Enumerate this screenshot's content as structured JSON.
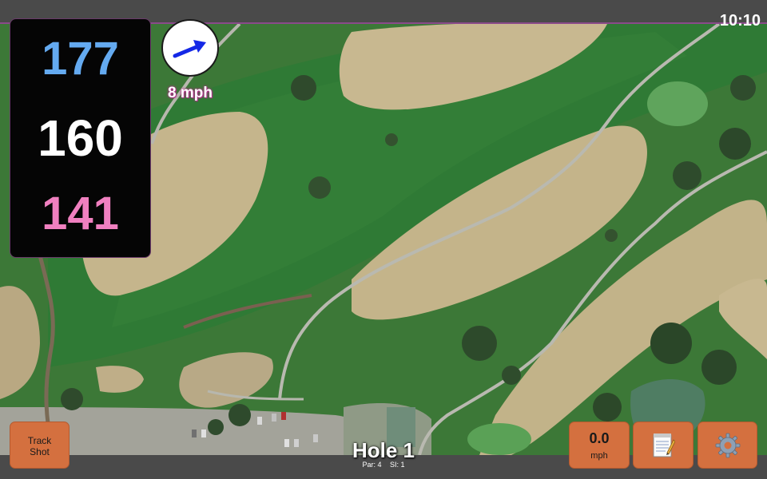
{
  "status_bar": {
    "time": "10:10"
  },
  "distances": {
    "back": "177",
    "middle": "160",
    "front": "141"
  },
  "wind": {
    "speed": "8 mph",
    "arrow_icon": "wind-arrow-icon"
  },
  "hole": {
    "title": "Hole 1",
    "par": "Par: 4",
    "stroke_index": "SI: 1"
  },
  "buttons": {
    "track_shot": [
      "Track",
      "Shot"
    ],
    "speed_value": "0.0",
    "speed_unit": "mph",
    "notes_icon": "notepad-icon",
    "settings_icon": "gear-icon"
  },
  "colors": {
    "back_distance": "#64aaf0",
    "middle_distance": "#ffffff",
    "front_distance": "#f080c0",
    "button": "#d4703f",
    "wind_arrow": "#1428e6"
  }
}
